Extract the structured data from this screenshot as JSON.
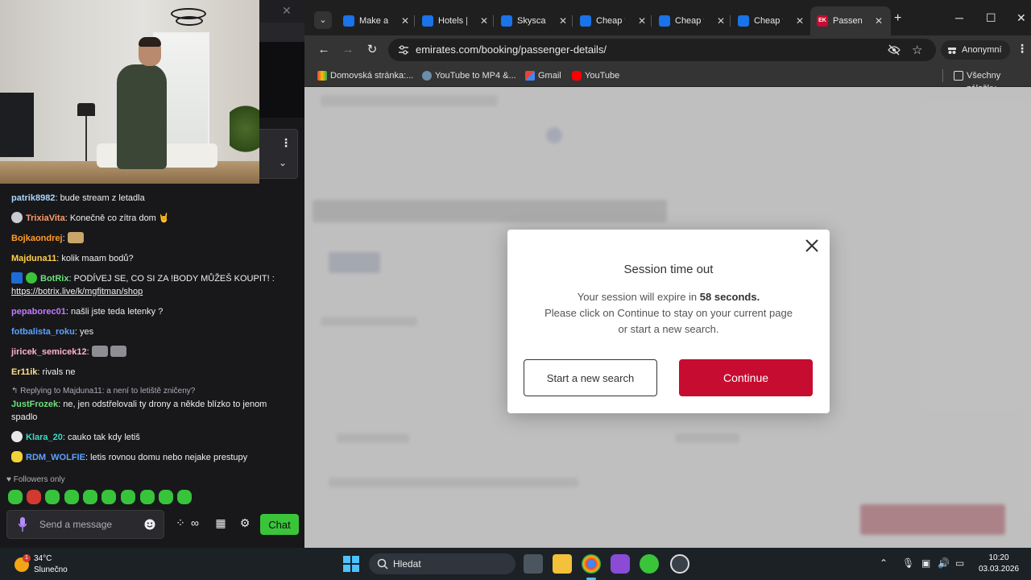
{
  "chat": {
    "messages": [
      {
        "user": "patrik8982",
        "color": "#a9d6ff",
        "text": "bude stream z letadla"
      },
      {
        "user": "TrixiaVita",
        "color": "#ff9c6b",
        "text": "Konečně co zítra dom 🤘"
      },
      {
        "user": "Bojkaondrej",
        "color": "#ff9c28",
        "text": ""
      },
      {
        "user": "Majduna11",
        "color": "#ffcf4d",
        "text": "kolik maam bodů?"
      },
      {
        "user": "BotRix",
        "color": "#6ee07a",
        "text": "PODÍVEJ SE, CO SI ZA !BODY MŮŽEŠ KOUPIT! :",
        "link": "https://botrix.live/k/mgfitman/shop"
      },
      {
        "user": "pepaborec01",
        "color": "#c27bff",
        "text": "našli jste teda letenky ?"
      },
      {
        "user": "fotbalista_roku",
        "color": "#5ea2ff",
        "text": "yes"
      },
      {
        "user": "jiricek_semicek12",
        "color": "#ffb3c8",
        "text": ""
      },
      {
        "user": "Er11ik",
        "color": "#ffe08a",
        "text": "rivals ne"
      },
      {
        "user": "JustFrozek",
        "color": "#6ee07a",
        "text": "ne, jen odstřelovali ty drony a někde blízko to jenom spadlo",
        "reply": "Replying to Majduna11: a není to letiště zničeny?"
      },
      {
        "user": "Klara_20",
        "color": "#3fd9c3",
        "text": "cauko tak kdy letiš"
      },
      {
        "user": "RDM_WOLFIE",
        "color": "#5ea2ff",
        "text": "letis rovnou domu nebo nejake prestupy"
      }
    ],
    "followers_only": "Followers only",
    "input_placeholder": "Send a message",
    "chat_button": "Chat"
  },
  "browser": {
    "tabs": [
      {
        "title": "Make a",
        "favicon_color": "#1a73e8"
      },
      {
        "title": "Hotels |",
        "favicon_color": "#1a73e8"
      },
      {
        "title": "Skyscann",
        "favicon_color": "#1a73e8"
      },
      {
        "title": "Cheap fli",
        "favicon_color": "#1a73e8"
      },
      {
        "title": "Cheap fli",
        "favicon_color": "#1a73e8"
      },
      {
        "title": "Cheap fli",
        "favicon_color": "#1a73e8"
      },
      {
        "title": "Passenge",
        "favicon_color": "#c60c30",
        "favicon_text": "EK",
        "active": true
      }
    ],
    "url": "emirates.com/booking/passenger-details/",
    "profile": "Anonymní",
    "bookmarks": [
      "Domovská stránka:...",
      "YouTube to MP4 &...",
      "Gmail",
      "YouTube"
    ],
    "all_bookmarks": "Všechny záložky",
    "accent": "#c60c30"
  },
  "modal": {
    "title": "Session time out",
    "line1_prefix": "Your session will expire in ",
    "line1_time": "58 seconds.",
    "line2": "Please click on Continue to stay on your current page",
    "line3": "or start a new search.",
    "start_new": "Start a new search",
    "continue": "Continue"
  },
  "taskbar": {
    "temp": "34°C",
    "condition": "Slunečno",
    "weather_badge": "1",
    "search_placeholder": "Hledat",
    "time": "10:20",
    "date": "03.03.2026"
  }
}
